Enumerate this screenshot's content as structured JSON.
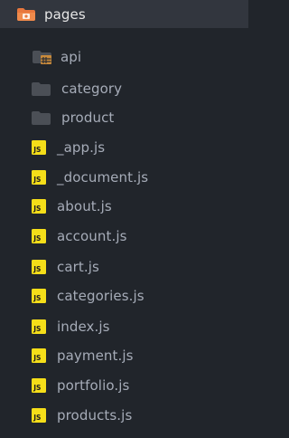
{
  "explorer": {
    "root": {
      "label": "pages",
      "icon": "folder-open-src-icon"
    },
    "items": [
      {
        "label": "api",
        "icon": "folder-api-icon",
        "type": "folder"
      },
      {
        "label": "category",
        "icon": "folder-icon",
        "type": "folder"
      },
      {
        "label": "product",
        "icon": "folder-icon",
        "type": "folder"
      },
      {
        "label": "_app.js",
        "icon": "js-file-icon",
        "type": "file"
      },
      {
        "label": "_document.js",
        "icon": "js-file-icon",
        "type": "file"
      },
      {
        "label": "about.js",
        "icon": "js-file-icon",
        "type": "file"
      },
      {
        "label": "account.js",
        "icon": "js-file-icon",
        "type": "file"
      },
      {
        "label": "cart.js",
        "icon": "js-file-icon",
        "type": "file"
      },
      {
        "label": "categories.js",
        "icon": "js-file-icon",
        "type": "file"
      },
      {
        "label": "index.js",
        "icon": "js-file-icon",
        "type": "file"
      },
      {
        "label": "payment.js",
        "icon": "js-file-icon",
        "type": "file"
      },
      {
        "label": "portfolio.js",
        "icon": "js-file-icon",
        "type": "file"
      },
      {
        "label": "products.js",
        "icon": "js-file-icon",
        "type": "file"
      }
    ]
  },
  "colors": {
    "background": "#21252b",
    "selected_row": "#32363e",
    "root_text": "#e6e6e6",
    "item_text": "#a6acb8",
    "js_badge": "#f5de19",
    "folder": "#4b4f56",
    "root_folder": "#e8773d"
  }
}
